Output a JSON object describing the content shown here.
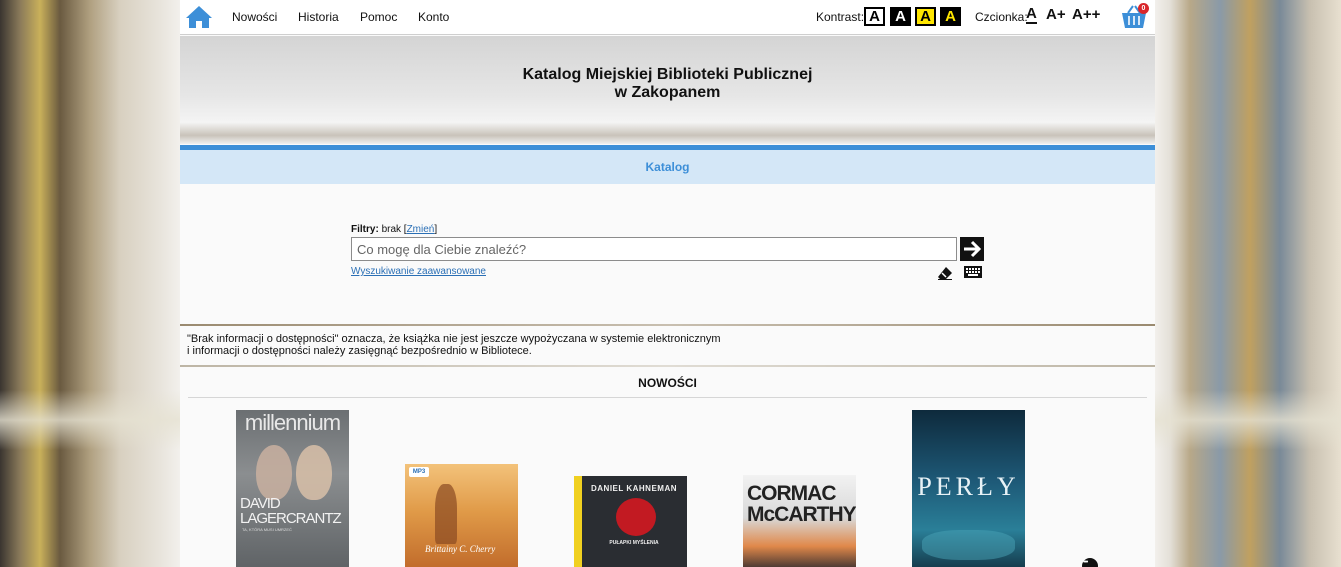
{
  "nav": {
    "links": [
      "Nowości",
      "Historia",
      "Pomoc",
      "Konto"
    ],
    "kontrast_label": "Kontrast:",
    "kontrast_options": [
      "A",
      "A",
      "A",
      "A"
    ],
    "czcionka_label": "Czcionka:",
    "font_sizes": [
      "A",
      "A+",
      "A++"
    ],
    "cart_count": "0",
    "accent_color": "#3d8fd8"
  },
  "header": {
    "title_line1": "Katalog Miejskiej Biblioteki Publicznej",
    "title_line2": "w Zakopanem"
  },
  "catalog_tab": "Katalog",
  "search": {
    "filters_label": "Filtry:",
    "filters_value": "brak",
    "filters_change": "Zmień",
    "placeholder": "Co mogę dla Ciebie znaleźć?",
    "advanced_link": "Wyszukiwanie zaawansowane"
  },
  "info": {
    "line1": "\"Brak informacji o dostępności\" oznacza, że książka nie jest jeszcze wypożyczana w systemie elektronicznym",
    "line2": "i informacji o dostępności należy zasięgnąć bezpośrednio w Bibliotece."
  },
  "news": {
    "title": "NOWOŚCI",
    "books": [
      {
        "series": "millennium",
        "author": "DAVID LAGERCRANTZ",
        "subtitle": "TA, KTÓRA MUSI UMRZEĆ"
      },
      {
        "badge": "MP3",
        "author": "Brittainy C. Cherry"
      },
      {
        "author": "DANIEL KAHNEMAN",
        "title": "PUŁAPKI MYŚLENIA"
      },
      {
        "author": "CORMAC McCARTHY"
      },
      {
        "title": "PERŁY"
      }
    ]
  }
}
